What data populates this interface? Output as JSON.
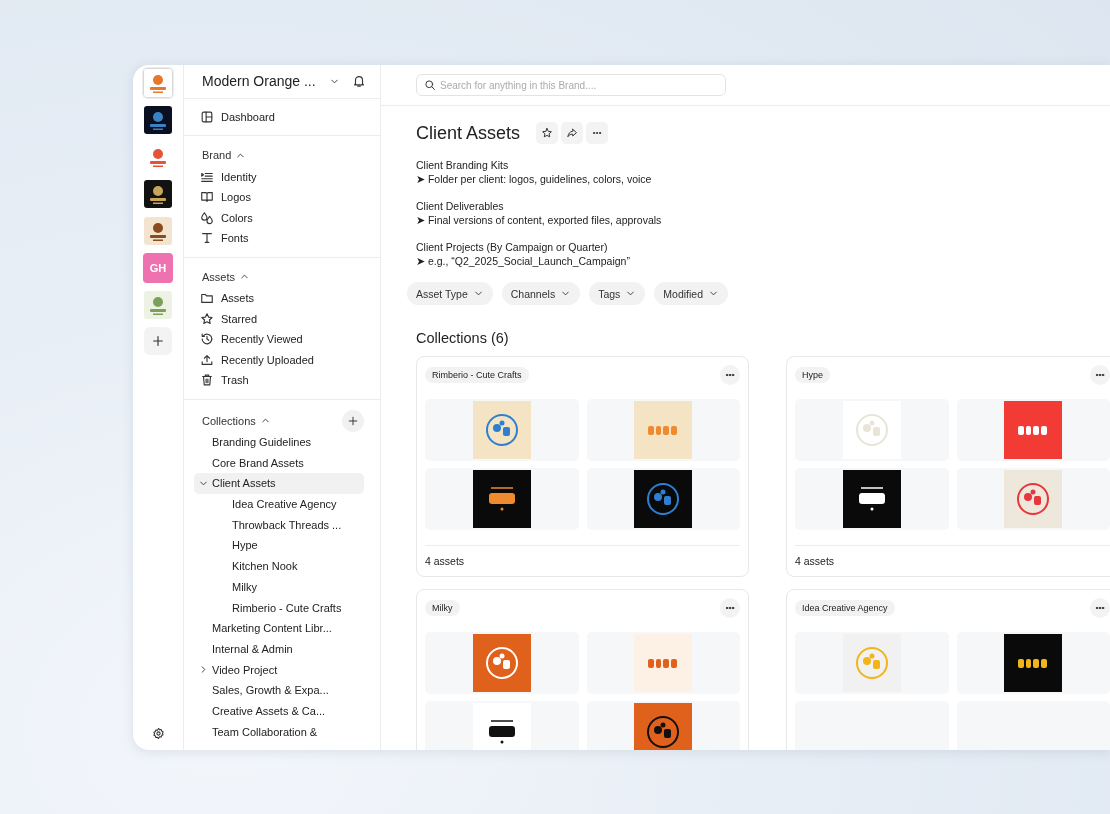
{
  "rail": {
    "items": [
      {
        "kind": "picture",
        "selected": true
      },
      {
        "kind": "picture",
        "selected": false
      },
      {
        "kind": "picture",
        "selected": false
      },
      {
        "kind": "picture",
        "selected": false
      },
      {
        "kind": "picture",
        "selected": false
      },
      {
        "kind": "initials",
        "text": "GH",
        "color": "#ee72b0",
        "selected": false
      },
      {
        "kind": "picture",
        "selected": false
      }
    ]
  },
  "sidebar": {
    "brand": "Modern Orange ...",
    "dashboard": "Dashboard",
    "sections": [
      {
        "title": "Brand",
        "expanded": true,
        "items": [
          "Identity",
          "Logos",
          "Colors",
          "Fonts"
        ]
      },
      {
        "title": "Assets",
        "expanded": true,
        "items": [
          "Assets",
          "Starred",
          "Recently Viewed",
          "Recently Uploaded",
          "Trash"
        ]
      }
    ],
    "collections": {
      "title": "Collections",
      "expanded": true,
      "items": [
        {
          "label": "Branding Guidelines",
          "selected": false
        },
        {
          "label": "Core Brand Assets",
          "selected": false
        },
        {
          "label": "Client Assets",
          "selected": true,
          "expanded": true,
          "children": [
            {
              "label": "Idea Creative Agency",
              "selected": false
            },
            {
              "label": "Throwback Threads ...",
              "selected": false
            },
            {
              "label": "Hype",
              "selected": false
            },
            {
              "label": "Kitchen Nook",
              "selected": false
            },
            {
              "label": "Milky",
              "selected": false
            },
            {
              "label": "Rimberio - Cute Crafts",
              "selected": false
            }
          ]
        },
        {
          "label": "Marketing Content Libr...",
          "selected": false
        },
        {
          "label": "Internal & Admin",
          "selected": false
        },
        {
          "label": "Video Project",
          "selected": false,
          "expanded": false
        },
        {
          "label": "Sales, Growth & Expa...",
          "selected": false
        },
        {
          "label": "Creative Assets & Ca...",
          "selected": false
        },
        {
          "label": "Team Collaboration &",
          "selected": false
        }
      ]
    }
  },
  "search": {
    "placeholder": "Search for anything in this Brand...."
  },
  "page": {
    "title": "Client Assets",
    "description": [
      {
        "heading": "Client Branding Kits",
        "line": "➤ Folder per client: logos, guidelines, colors, voice"
      },
      {
        "heading": "Client Deliverables",
        "line": "➤ Final versions of content, exported files, approvals"
      },
      {
        "heading": "Client Projects (By Campaign or Quarter)",
        "line": "➤ e.g., “Q2_2025_Social_Launch_Campaign”"
      }
    ],
    "filters": [
      "Asset Type",
      "Channels",
      "Tags",
      "Modified"
    ],
    "collections_heading": "Collections (6)",
    "cards": [
      {
        "name": "Rimberio - Cute Crafts",
        "count": "4 assets",
        "thumbs": [
          {
            "kind": "picture"
          },
          {
            "kind": "picture"
          },
          {
            "kind": "picture"
          },
          {
            "kind": "picture"
          }
        ]
      },
      {
        "name": "Hype",
        "count": "4 assets",
        "thumbs": [
          {
            "kind": "picture"
          },
          {
            "kind": "picture"
          },
          {
            "kind": "picture"
          },
          {
            "kind": "picture"
          }
        ]
      },
      {
        "name": "Milky",
        "thumbs": [
          {
            "kind": "picture"
          },
          {
            "kind": "picture"
          },
          {
            "kind": "picture"
          },
          {
            "kind": "picture"
          }
        ]
      },
      {
        "name": "Idea Creative Agency",
        "thumbs": [
          {
            "kind": "picture"
          },
          {
            "kind": "picture"
          }
        ]
      }
    ]
  }
}
